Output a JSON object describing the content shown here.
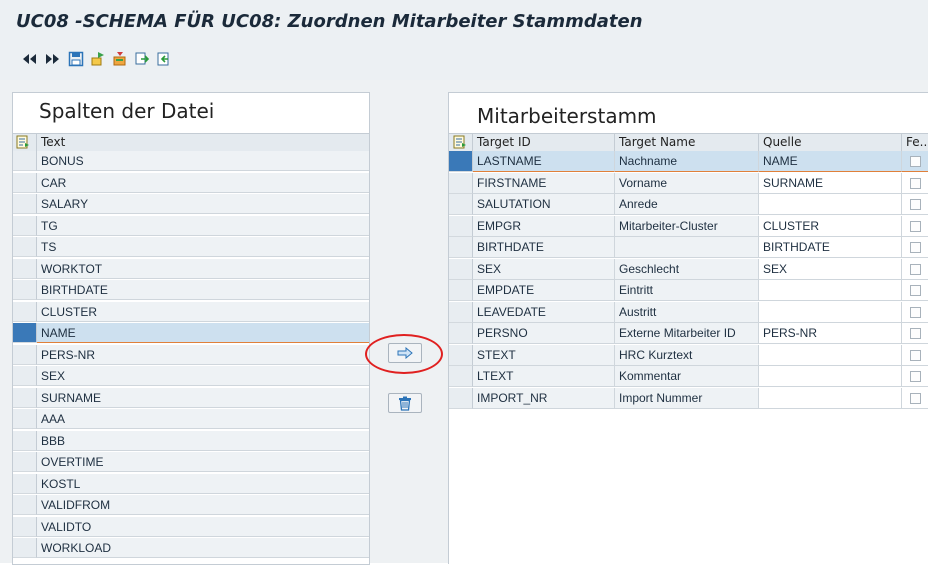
{
  "window": {
    "title": "UC08 -SCHEMA FÜR UC08: Zuordnen Mitarbeiter Stammdaten"
  },
  "toolbar": {
    "icons": [
      "first-page-icon",
      "last-page-icon",
      "save-icon",
      "import-icon",
      "export-icon",
      "copy-icon",
      "paste-icon"
    ]
  },
  "left_panel": {
    "title": "Spalten der Datei",
    "column_header": "Text",
    "rows": [
      "BONUS",
      "CAR",
      "SALARY",
      "TG",
      "TS",
      "WORKTOT",
      "BIRTHDATE",
      "CLUSTER",
      "NAME",
      "PERS-NR",
      "SEX",
      "SURNAME",
      "AAA",
      "BBB",
      "OVERTIME",
      "KOSTL",
      "VALIDFROM",
      "VALIDTO",
      "WORKLOAD"
    ],
    "selected_row": "NAME"
  },
  "middle": {
    "assign_button_icon": "arrow-right-icon",
    "delete_button_icon": "trash-icon"
  },
  "right_panel": {
    "title": "Mitarbeiterstamm",
    "headers": {
      "target_id": "Target ID",
      "target_name": "Target Name",
      "quelle": "Quelle",
      "fe": "Fe..."
    },
    "rows": [
      {
        "id": "LASTNAME",
        "name": "Nachname",
        "quelle": "NAME"
      },
      {
        "id": "FIRSTNAME",
        "name": "Vorname",
        "quelle": "SURNAME"
      },
      {
        "id": "SALUTATION",
        "name": "Anrede",
        "quelle": ""
      },
      {
        "id": "EMPGR",
        "name": "Mitarbeiter-Cluster",
        "quelle": "CLUSTER"
      },
      {
        "id": "BIRTHDATE",
        "name": "",
        "quelle": "BIRTHDATE"
      },
      {
        "id": "SEX",
        "name": "Geschlecht",
        "quelle": "SEX"
      },
      {
        "id": "EMPDATE",
        "name": "Eintritt",
        "quelle": ""
      },
      {
        "id": "LEAVEDATE",
        "name": "Austritt",
        "quelle": ""
      },
      {
        "id": "PERSNO",
        "name": "Externe Mitarbeiter ID",
        "quelle": "PERS-NR"
      },
      {
        "id": "STEXT",
        "name": "HRC Kurztext",
        "quelle": ""
      },
      {
        "id": "LTEXT",
        "name": "Kommentar",
        "quelle": ""
      },
      {
        "id": "IMPORT_NR",
        "name": "Import Nummer",
        "quelle": ""
      }
    ],
    "selected_row": "LASTNAME"
  },
  "colors": {
    "selection_blue": "#3a79b8",
    "highlight_row": "#cde0ef",
    "annotation_red": "#e02020"
  }
}
